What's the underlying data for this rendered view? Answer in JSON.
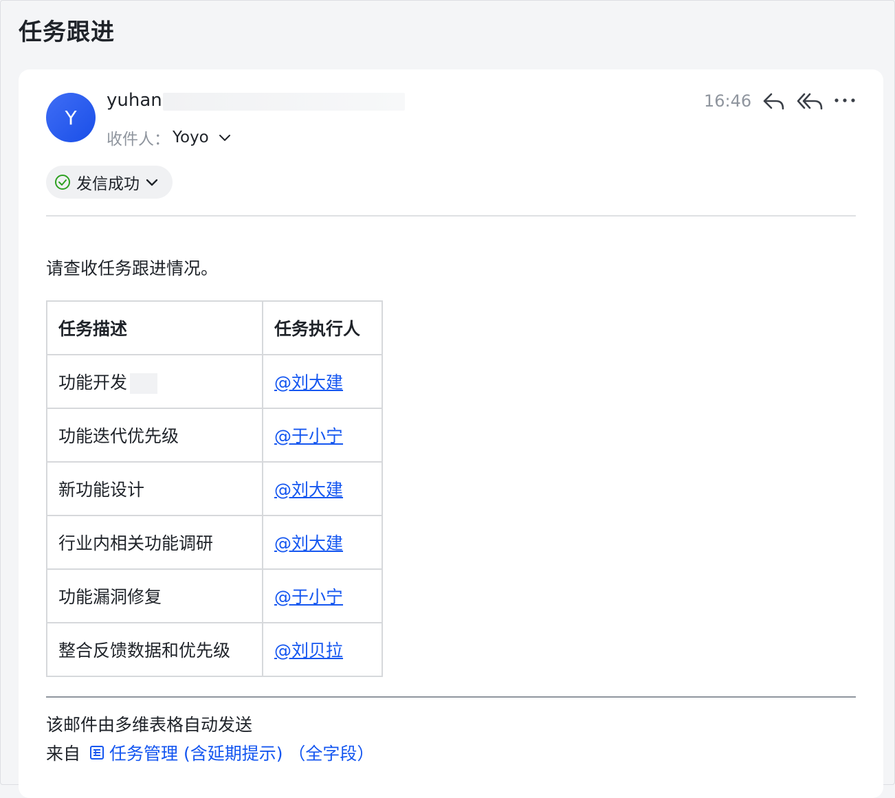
{
  "page": {
    "title": "任务跟进"
  },
  "message": {
    "avatar_letter": "Y",
    "sender_name": "yuhan",
    "recipient_label": "收件人：",
    "recipient_name": "Yoyo",
    "time": "16:46",
    "status": "发信成功",
    "icons": {
      "reply": "reply-icon",
      "reply_all": "reply-all-icon",
      "more": "more-icon"
    },
    "accent_color": "#1456f0",
    "success_color": "#2ea121"
  },
  "body": {
    "intro": "请查收任务跟进情况。",
    "table": {
      "headers": [
        "任务描述",
        "任务执行人"
      ],
      "rows": [
        {
          "desc": "功能开发",
          "owner": "@刘大建"
        },
        {
          "desc": "功能迭代优先级",
          "owner": "@于小宁"
        },
        {
          "desc": "新功能设计",
          "owner": "@刘大建"
        },
        {
          "desc": "行业内相关功能调研",
          "owner": "@刘大建"
        },
        {
          "desc": "功能漏洞修复",
          "owner": "@于小宁"
        },
        {
          "desc": "整合反馈数据和优先级",
          "owner": "@刘贝拉"
        }
      ]
    }
  },
  "footer": {
    "note": "该邮件由多维表格自动发送",
    "from_label": "来自",
    "source_link": "任务管理 (含延期提示) （全字段）"
  }
}
